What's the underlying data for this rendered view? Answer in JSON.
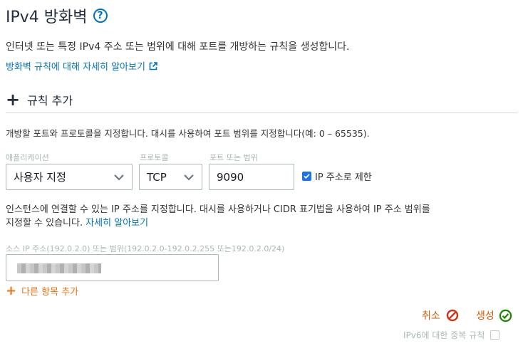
{
  "page": {
    "title": "IPv4 방화벽",
    "help_glyph": "?",
    "description": "인터넷 또는 특정 IPv4 주소 또는 범위에 대해 포트를 개방하는 규칙을 생성합니다.",
    "learn_more": "방화벽 규칙에 대해 자세히 알아보기"
  },
  "rule": {
    "add_label": "규칙 추가",
    "port_hint": "개방할 포트와 프로토콜을 지정합니다. 대시를 사용하여 포트 범위를 지정합니다(예: 0 – 65535).",
    "application_label": "애플리케이션",
    "application_value": "사용자 지정",
    "protocol_label": "프로토콜",
    "protocol_value": "TCP",
    "port_label": "포트 또는 범위",
    "port_value": "9090",
    "restrict_label": "IP 주소로 제한",
    "restrict_checked": true,
    "ip_hint": "인스턴스에 연결할 수 있는 IP 주소를 지정합니다. 대시를 사용하거나 CIDR 표기법을 사용하여 IP 주소 범위를 지정할 수 있습니다.",
    "ip_hint_link": "자세히 알아보기",
    "source_label": "소스 IP 주소(192.0.2.0) 또는 범위(192.0.2.0-192.0.2.255 또는192.0.2.0/24)",
    "add_more": "다른 항목 추가"
  },
  "actions": {
    "cancel": "취소",
    "create": "생성",
    "ipv6_duplicate": "IPv6에 대한 중복 규칙"
  },
  "colors": {
    "link": "#0073bb",
    "accent_orange": "#ec7211",
    "action_orange": "#d45b07",
    "cancel_red": "#d13212",
    "create_green": "#1d8102"
  },
  "icons": [
    "help-icon",
    "external-link-icon",
    "plus-icon",
    "chevron-down-icon",
    "check-icon",
    "cancel-icon",
    "create-check-icon"
  ]
}
